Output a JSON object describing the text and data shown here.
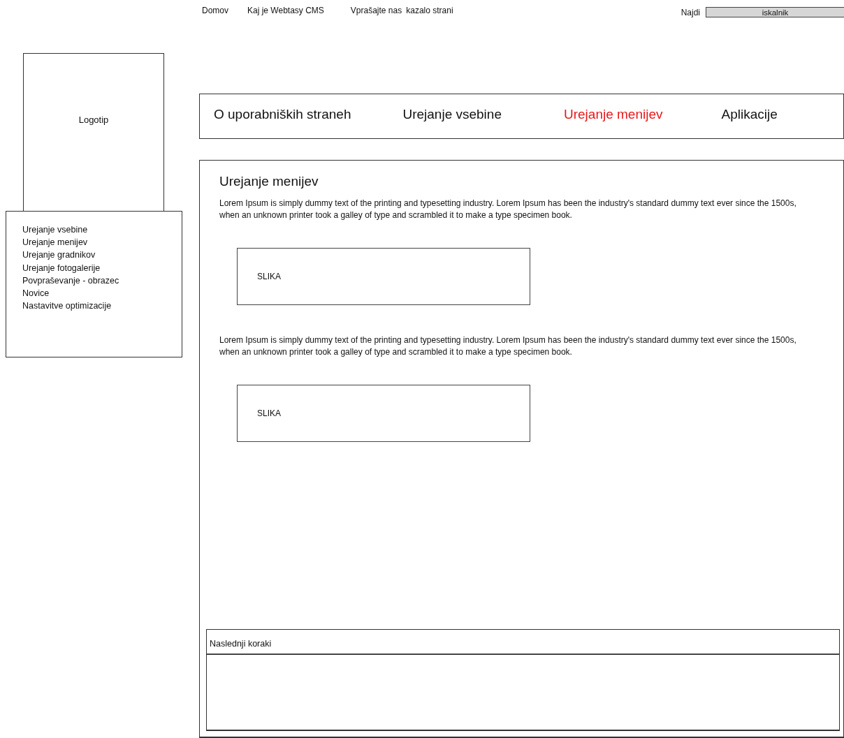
{
  "top_nav": {
    "links": [
      "Domov",
      "Kaj je Webtasy CMS",
      "Vprašajte nas",
      "kazalo strani"
    ]
  },
  "search": {
    "label": "Najdi",
    "placeholder": "iskalnik"
  },
  "logo": {
    "label": "Logotip"
  },
  "sidebar": {
    "items": [
      "Urejanje vsebine",
      "Urejanje menijev",
      "Urejanje gradnikov",
      "Urejanje fotogalerije",
      "Povpraševanje - obrazec",
      "Novice",
      "Nastavitve optimizacije"
    ]
  },
  "tabs": [
    {
      "label": "O uporabniških straneh",
      "selected": false
    },
    {
      "label": "Urejanje vsebine",
      "selected": false
    },
    {
      "label": "Urejanje menijev",
      "selected": true
    },
    {
      "label": "Aplikacije",
      "selected": false
    }
  ],
  "content": {
    "title": "Urejanje menijev",
    "blocks": [
      {
        "kind": "paragraph",
        "text": "Lorem Ipsum is simply dummy text of the printing and typesetting industry.  Lorem Ipsum has been the industry's standard dummy text ever since the 1500s,  when an unknown printer took a galley of type and scrambled it to make a type specimen book."
      },
      {
        "kind": "image",
        "label": "SLIKA"
      },
      {
        "kind": "paragraph",
        "text": "Lorem Ipsum is simply dummy text of the printing and typesetting industry.  Lorem Ipsum has been the industry's standard dummy text ever since the 1500s,  when an unknown printer took a galley of type and scrambled it to make a type specimen book."
      },
      {
        "kind": "image",
        "label": "SLIKA"
      }
    ]
  },
  "next_steps": {
    "title": "Naslednji koraki"
  }
}
